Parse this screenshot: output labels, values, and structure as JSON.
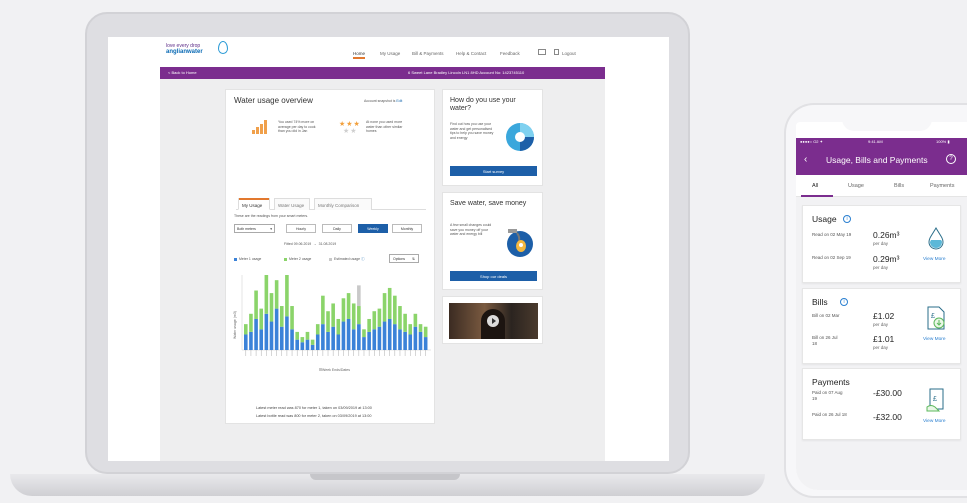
{
  "laptop": {
    "header": {
      "logo_tagline": "love every drop",
      "logo_name": "anglianwater",
      "nav": [
        "Home",
        "My Usage",
        "Bill & Payments",
        "Help & Contact",
        "Feedback"
      ],
      "logout_label": "Logout"
    },
    "purple_bar": {
      "back": "< Back to Home",
      "address": "6 Sweet Lane Bradley Lincoln LN1 8HD Account No: 1423745110"
    },
    "usage_overview": {
      "title": "Water usage overview",
      "account_label": "Account snapshot is",
      "account_link": "Edit",
      "insight_1": "You used 74% more on average per day to cook than you did in Jan",
      "insight_2": "At none you used more water than other similar homes",
      "tabs": [
        "My Usage",
        "Water Usage",
        "Monthly Comparison"
      ],
      "intro": "These are the readings from your smart meters.",
      "select_value": "Both meters",
      "periods": [
        "Hourly",
        "Daily",
        "Weekly",
        "Monthly"
      ],
      "active_period": "Weekly",
      "date_from": "Fitted 09.06.2019",
      "date_to": "31.08.2019",
      "legend": [
        "Meter 1 usage",
        "Meter 2 usage",
        "Estimated usage"
      ],
      "options_label": "Options",
      "x_caption": "Week Ends/Dates",
      "footnote_1": "Latest meter read was 870 for meter 1, taken on 03/09/2019 at 13:00",
      "footnote_2": "Latest bottle read was 800 for meter 2, taken on 03/09/2019 at 13:00"
    },
    "side": {
      "card1_title": "How do you use your water?",
      "card1_text": "Find out how you use your water and get personalised tips to help you save money and energy",
      "card1_button": "Start survey",
      "card2_title": "Save water, save money",
      "card2_text": "A few small changes could save you money off your water and energy bill",
      "card2_button": "Shop our deals"
    }
  },
  "chart_data": {
    "type": "bar",
    "stacked": true,
    "title": "",
    "xlabel": "",
    "ylabel": "",
    "series": [
      {
        "name": "Meter 1 usage",
        "color": "#3b82d8",
        "values": [
          30,
          35,
          60,
          40,
          70,
          55,
          80,
          45,
          65,
          40,
          20,
          15,
          20,
          10,
          30,
          50,
          35,
          45,
          30,
          55,
          60,
          40,
          50,
          25,
          35,
          40,
          45,
          55,
          60,
          50,
          40,
          35,
          30,
          45,
          35,
          25
        ]
      },
      {
        "name": "Meter 2 usage",
        "color": "#8bd46a",
        "values": [
          20,
          35,
          55,
          40,
          75,
          55,
          55,
          40,
          80,
          45,
          15,
          10,
          15,
          10,
          20,
          55,
          40,
          45,
          30,
          45,
          50,
          50,
          35,
          15,
          25,
          35,
          35,
          55,
          60,
          55,
          45,
          35,
          20,
          25,
          15,
          20
        ]
      },
      {
        "name": "Estimated usage",
        "color": "#c9c9c9",
        "values": [
          0,
          0,
          0,
          0,
          0,
          0,
          0,
          0,
          0,
          0,
          0,
          0,
          0,
          0,
          0,
          0,
          0,
          0,
          0,
          0,
          0,
          0,
          40,
          0,
          0,
          0,
          0,
          0,
          0,
          0,
          0,
          0,
          0,
          0,
          0,
          0
        ]
      }
    ],
    "grid": false,
    "legend_position": "top"
  },
  "phone": {
    "status": {
      "carrier": "●●●●○ O2 ✦",
      "time": "9:41 AM",
      "battery": "100% ▮"
    },
    "app_title": "Usage, Bills and Payments",
    "help": "?",
    "tabs": [
      "All",
      "Usage",
      "Bills",
      "Payments"
    ],
    "usage": {
      "title": "Usage",
      "rows": [
        {
          "label": "Read on 02 May 19",
          "value": "0.26m³",
          "sub": "per day"
        },
        {
          "label": "Read on 02 Sep 19",
          "value": "0.29m³",
          "sub": "per day"
        }
      ],
      "link": "View More"
    },
    "bills": {
      "title": "Bills",
      "rows": [
        {
          "label": "Bill on 02 Mar",
          "value": "£1.02",
          "sub": "per day"
        },
        {
          "label": "Bill on 26 Jul 18",
          "value": "£1.01",
          "sub": "per day"
        }
      ],
      "link": "View More"
    },
    "payments": {
      "title": "Payments",
      "rows": [
        {
          "label": "Paid on 07 Aug 19",
          "value": "-£30.00"
        },
        {
          "label": "Paid on 26 Jul 18",
          "value": "-£32.00"
        }
      ],
      "link": "View More"
    }
  }
}
